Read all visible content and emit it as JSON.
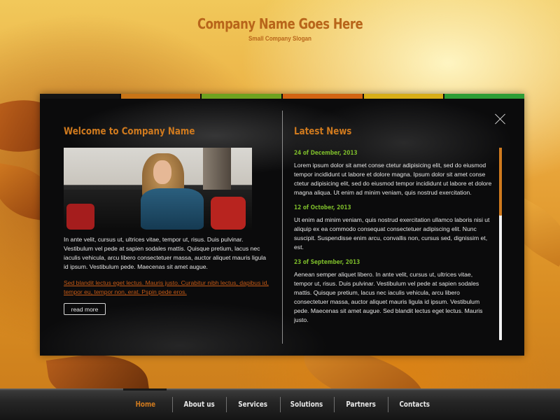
{
  "header": {
    "company_name": "Company Name Goes Here",
    "slogan": "Small Company Slogan"
  },
  "colors": {
    "accent_orange": "#d07a1e",
    "date_green": "#7bb92a",
    "link_orange": "#c55a16",
    "color_bar": [
      "#141414",
      "#c87417",
      "#6ea21f",
      "#d26413",
      "#d8ae17",
      "#2d9d36"
    ]
  },
  "welcome": {
    "title": "Welcome to Company Name",
    "text": "In ante velit, cursus ut, ultrices vitae, tempor ut, risus. Duis pulvinar. Vestibulum vel pede at sapien sodales mattis. Quisque pretium, lacus nec iaculis vehicula, arcu libero consectetuer massa, auctor aliquet mauris ligula id ipsum. Vestibulum pede. Maecenas sit amet augue.",
    "link_text": "Sed blandit lectus eget lectus. Mauris justo. Curabitur nibh lectus, dapibus id, tempor eu, tempor non, erat. Pspin pede eros.",
    "read_more_label": "read more"
  },
  "news": {
    "title": "Latest News",
    "items": [
      {
        "date": "24 of December, 2013",
        "text": "Lorem ipsum dolor sit amet conse ctetur adipisicing elit, sed do eiusmod tempor incididunt ut labore et dolore magna. Ipsum dolor sit amet conse ctetur adipisicing elit, sed do eiusmod tempor incididunt ut labore et dolore magna aliqua. Ut enim ad minim veniam, quis nostrud exercitation."
      },
      {
        "date": "12 of October, 2013",
        "text": "Ut enim ad minim veniam, quis nostrud exercitation ullamco laboris nisi ut aliquip ex ea commodo consequat consectetuer adipiscing elit. Nunc suscipit. Suspendisse enim arcu, convallis non, cursus sed, dignissim et, est."
      },
      {
        "date": "23 of September, 2013",
        "text": "Aenean semper aliquet libero. In ante velit, cursus ut, ultrices vitae, tempor ut, risus. Duis pulvinar. Vestibulum vel pede at sapien sodales mattis. Quisque pretium, lacus nec iaculis vehicula, arcu libero consectetuer massa, auctor aliquet mauris ligula id ipsum. Vestibulum pede. Maecenas sit amet augue. Sed blandit lectus eget lectus. Mauris justo."
      }
    ],
    "scroll_position": 0
  },
  "nav": {
    "items": [
      "Home",
      "About us",
      "Services",
      "Solutions",
      "Partners",
      "Contacts"
    ],
    "active": "Home"
  }
}
